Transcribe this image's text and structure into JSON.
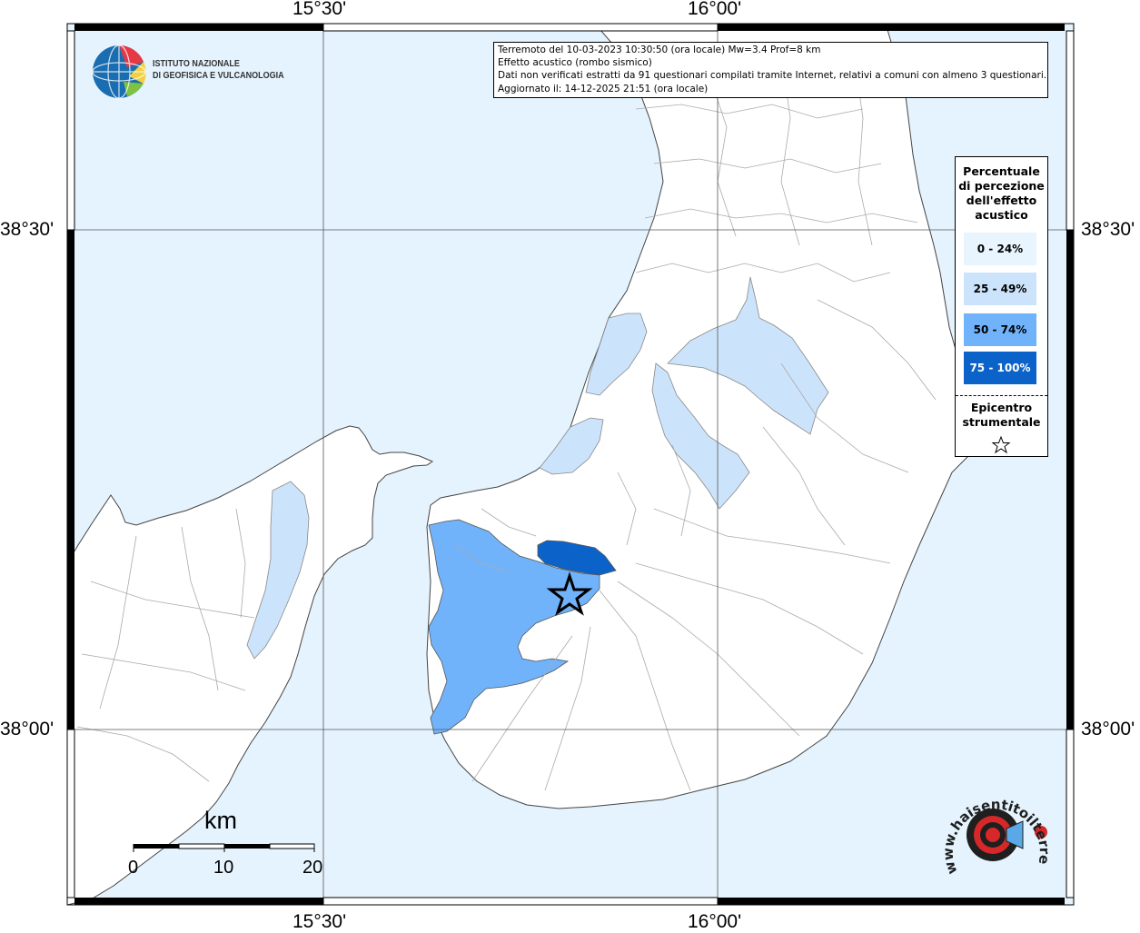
{
  "map": {
    "longitude_labels": [
      "15°30'",
      "16°00'"
    ],
    "latitude_labels": [
      "38°30'",
      "38°00'"
    ],
    "colors": {
      "sea": "#e4f3fd",
      "land": "#ffffff",
      "class_0_24": "#e8f5fe",
      "class_25_49": "#cce4fb",
      "class_50_74": "#71b3fb",
      "class_75_100": "#0b63c9",
      "boundaries": "#aaaaaa"
    }
  },
  "info": {
    "line1": "Terremoto del 10-03-2023 10:30:50 (ora locale) Mw=3.4 Prof=8 km",
    "line2": "Effetto acustico (rombo sismico)",
    "line3": "Dati non verificati estratti da 91 questionari compilati tramite Internet, relativi a comuni con almeno 3 questionari.",
    "line4": "Aggiornato il: 14-12-2025 21:51 (ora locale)"
  },
  "legend": {
    "title_lines": [
      "Percentuale",
      "di percezione",
      "dell'effetto",
      "acustico"
    ],
    "classes": [
      {
        "label": "0 - 24%",
        "color": "#e8f5fe",
        "text_color": "#000000"
      },
      {
        "label": "25 - 49%",
        "color": "#cce4fb",
        "text_color": "#000000"
      },
      {
        "label": "50 - 74%",
        "color": "#71b3fb",
        "text_color": "#000000"
      },
      {
        "label": "75 - 100%",
        "color": "#0b63c9",
        "text_color": "#ffffff"
      }
    ],
    "epicenter_lines": [
      "Epicentro",
      "strumentale"
    ],
    "epicenter_icon": "star-outline-icon"
  },
  "logos": {
    "ingv_name_lines": [
      "ISTITUTO NAZIONALE",
      "DI GEOFISICA E VULCANOLOGIA"
    ],
    "hst_text": "www.haisentitoilterremoto.it"
  },
  "scale": {
    "unit": "km",
    "ticks": [
      "0",
      "10",
      "20"
    ]
  },
  "epicenter": {
    "icon": "star-outline-icon"
  }
}
